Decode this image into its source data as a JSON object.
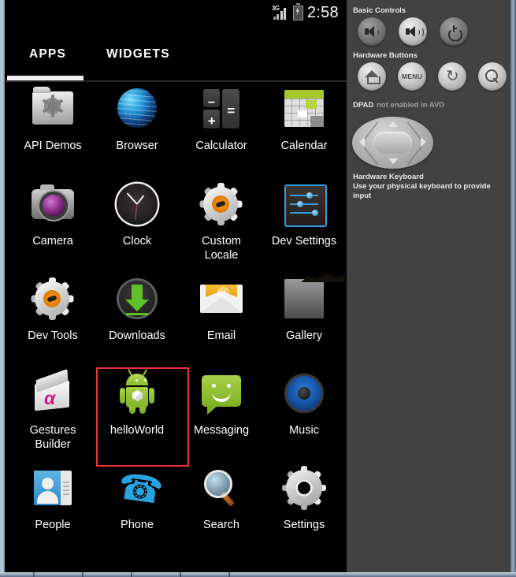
{
  "statusbar": {
    "network_label": "3G",
    "clock": "2:58",
    "battery_state": "charging"
  },
  "tabs": {
    "apps": "APPS",
    "widgets": "WIDGETS",
    "selected": "APPS"
  },
  "apps": [
    {
      "label": "API Demos",
      "icon": "folder-gear-icon"
    },
    {
      "label": "Browser",
      "icon": "globe-icon"
    },
    {
      "label": "Calculator",
      "icon": "calculator-icon"
    },
    {
      "label": "Calendar",
      "icon": "calendar-icon"
    },
    {
      "label": "Camera",
      "icon": "camera-icon"
    },
    {
      "label": "Clock",
      "icon": "clock-icon"
    },
    {
      "label": "Custom\nLocale",
      "icon": "gear-orange-icon"
    },
    {
      "label": "Dev Settings",
      "icon": "sliders-icon"
    },
    {
      "label": "Dev Tools",
      "icon": "gear-orange-icon"
    },
    {
      "label": "Downloads",
      "icon": "download-arrow-icon"
    },
    {
      "label": "Email",
      "icon": "envelope-at-icon"
    },
    {
      "label": "Gallery",
      "icon": "picture-frame-icon"
    },
    {
      "label": "Gestures\nBuilder",
      "icon": "gesture-pad-icon"
    },
    {
      "label": "helloWorld",
      "icon": "android-robot-icon"
    },
    {
      "label": "Messaging",
      "icon": "speech-bubble-icon"
    },
    {
      "label": "Music",
      "icon": "speaker-icon"
    },
    {
      "label": "People",
      "icon": "contact-card-icon"
    },
    {
      "label": "Phone",
      "icon": "handset-icon"
    },
    {
      "label": "Search",
      "icon": "magnifier-icon"
    },
    {
      "label": "Settings",
      "icon": "gear-icon"
    }
  ],
  "highlight": {
    "target_app": "helloWorld",
    "color": "#ed3237"
  },
  "panel": {
    "basic_controls_title": "Basic Controls",
    "basic_controls": [
      {
        "label": "volume-down-button",
        "icon": "speaker-low-icon"
      },
      {
        "label": "volume-up-button",
        "icon": "speaker-high-icon"
      },
      {
        "label": "power-button",
        "icon": "power-icon"
      }
    ],
    "hardware_buttons_title": "Hardware Buttons",
    "hardware_buttons": [
      {
        "label": "home-button",
        "icon": "home-icon"
      },
      {
        "label": "MENU",
        "icon": "menu-text-icon"
      },
      {
        "label": "back-button",
        "icon": "back-arrow-icon"
      },
      {
        "label": "search-button",
        "icon": "magnifier-icon"
      }
    ],
    "dpad_title": "DPAD",
    "dpad_status": "not enabled in AVD",
    "keyboard_title": "Hardware Keyboard",
    "keyboard_hint": "Use your physical keyboard to provide input"
  }
}
